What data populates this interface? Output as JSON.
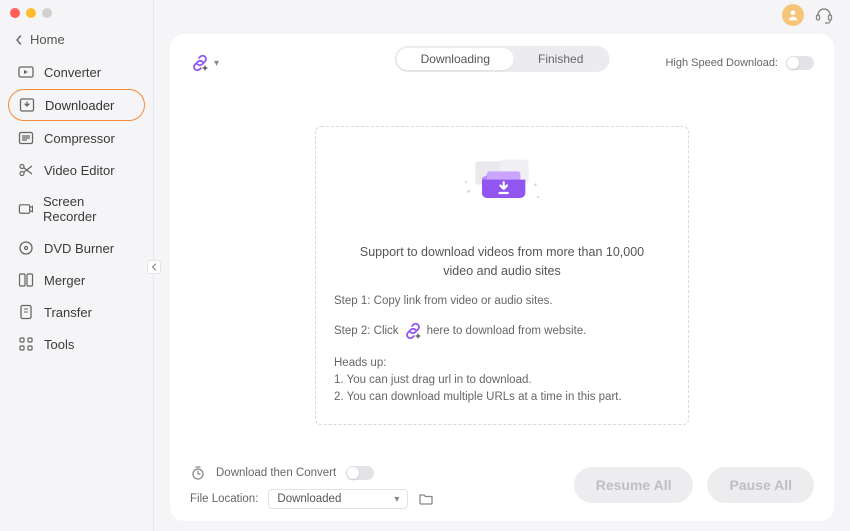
{
  "home_label": "Home",
  "sidebar": {
    "items": [
      {
        "label": "Converter"
      },
      {
        "label": "Downloader"
      },
      {
        "label": "Compressor"
      },
      {
        "label": "Video Editor"
      },
      {
        "label": "Screen Recorder"
      },
      {
        "label": "DVD Burner"
      },
      {
        "label": "Merger"
      },
      {
        "label": "Transfer"
      },
      {
        "label": "Tools"
      }
    ],
    "active_index": 1
  },
  "tabs": {
    "downloading": "Downloading",
    "finished": "Finished",
    "active": "downloading"
  },
  "high_speed_label": "High Speed Download:",
  "drop": {
    "title": "Support to download videos from more than 10,000 video and audio sites",
    "step1": "Step 1: Copy link from video or audio sites.",
    "step2_a": "Step 2: Click",
    "step2_b": "here to download from website.",
    "heads_title": "Heads up:",
    "heads_1": "1. You can just drag url in to download.",
    "heads_2": "2. You can download multiple URLs at a time in this part."
  },
  "footer": {
    "convert_label": "Download then Convert",
    "location_label": "File Location:",
    "location_value": "Downloaded",
    "resume": "Resume All",
    "pause": "Pause All"
  },
  "colors": {
    "accent": "#9156f0",
    "active_border": "#f58a3c"
  }
}
